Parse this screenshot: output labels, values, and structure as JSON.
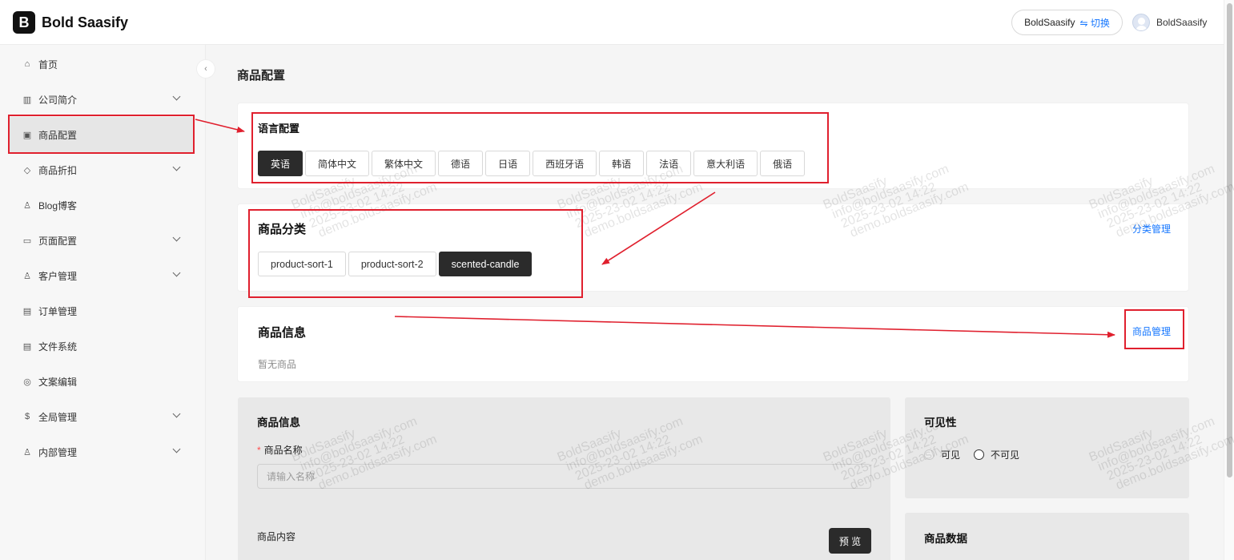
{
  "app": {
    "logo_letter": "B",
    "name": "Bold Saasify"
  },
  "header": {
    "tenant": "BoldSaasify",
    "switch_label": "⇋ 切换",
    "user_name": "BoldSaasify"
  },
  "sidebar": {
    "items": [
      {
        "label": "首页",
        "icon": "home-icon",
        "glyph": "⌂",
        "has_children": false,
        "active": false
      },
      {
        "label": "公司简介",
        "icon": "building-icon",
        "glyph": "▥",
        "has_children": true,
        "active": false
      },
      {
        "label": "商品配置",
        "icon": "box-icon",
        "glyph": "▣",
        "has_children": false,
        "active": true
      },
      {
        "label": "商品折扣",
        "icon": "tag-icon",
        "glyph": "◇",
        "has_children": true,
        "active": false
      },
      {
        "label": "Blog博客",
        "icon": "users-icon",
        "glyph": "♙",
        "has_children": false,
        "active": false
      },
      {
        "label": "页面配置",
        "icon": "monitor-icon",
        "glyph": "▭",
        "has_children": true,
        "active": false
      },
      {
        "label": "客户管理",
        "icon": "customers-icon",
        "glyph": "♙",
        "has_children": true,
        "active": false
      },
      {
        "label": "订单管理",
        "icon": "order-icon",
        "glyph": "▤",
        "has_children": false,
        "active": false
      },
      {
        "label": "文件系统",
        "icon": "file-icon",
        "glyph": "▤",
        "has_children": false,
        "active": false
      },
      {
        "label": "文案编辑",
        "icon": "globe-icon",
        "glyph": "◎",
        "has_children": false,
        "active": false
      },
      {
        "label": "全局管理",
        "icon": "dollar-icon",
        "glyph": "$",
        "has_children": true,
        "active": false
      },
      {
        "label": "内部管理",
        "icon": "user-icon",
        "glyph": "♙",
        "has_children": true,
        "active": false
      }
    ]
  },
  "main": {
    "title": "商品配置",
    "language": {
      "title": "语言配置",
      "options": [
        "英语",
        "简体中文",
        "繁体中文",
        "德语",
        "日语",
        "西班牙语",
        "韩语",
        "法语",
        "意大利语",
        "俄语"
      ],
      "selected": "英语"
    },
    "category": {
      "title": "商品分类",
      "manage_link": "分类管理",
      "options": [
        "product-sort-1",
        "product-sort-2",
        "scented-candle"
      ],
      "selected": "scented-candle"
    },
    "product_info": {
      "title": "商品信息",
      "manage_link": "商品管理",
      "empty_text": "暂无商品"
    },
    "form": {
      "section_title": "商品信息",
      "required_mark": "*",
      "name_label": "商品名称",
      "name_placeholder": "请输入名称",
      "content_label": "商品内容",
      "preview_button": "预 览"
    },
    "visibility": {
      "title": "可见性",
      "options": [
        "可见",
        "不可见"
      ]
    },
    "product_data": {
      "title": "商品数据"
    }
  },
  "watermark": {
    "lines": [
      "BoldSaasify",
      "info@boldsaasify.com",
      "2025-23-02 14:22",
      "demo.boldsaasify.com"
    ]
  },
  "colors": {
    "accent_dark": "#2b2b2b",
    "link": "#1677ff",
    "annotation": "#e0202e"
  }
}
